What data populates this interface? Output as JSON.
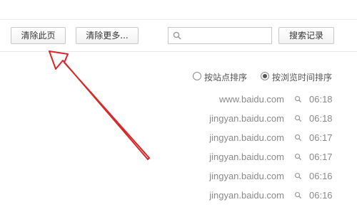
{
  "toolbar": {
    "clear_page_label": "清除此页",
    "clear_more_label": "清除更多...",
    "search_placeholder": "",
    "search_value": "",
    "search_records_label": "搜索记录"
  },
  "sort": {
    "by_site_label": "按站点排序",
    "by_time_label": "按浏览时间排序",
    "selected": "by_time"
  },
  "history": [
    {
      "domain": "www.baidu.com",
      "time": "06:18"
    },
    {
      "domain": "jingyan.baidu.com",
      "time": "06:18"
    },
    {
      "domain": "jingyan.baidu.com",
      "time": "06:17"
    },
    {
      "domain": "jingyan.baidu.com",
      "time": "06:17"
    },
    {
      "domain": "jingyan.baidu.com",
      "time": "06:16"
    },
    {
      "domain": "jingyan.baidu.com",
      "time": "06:16"
    }
  ],
  "annotation": {
    "arrow_color": "#d42a2a",
    "points_to": "clear-page-button"
  }
}
